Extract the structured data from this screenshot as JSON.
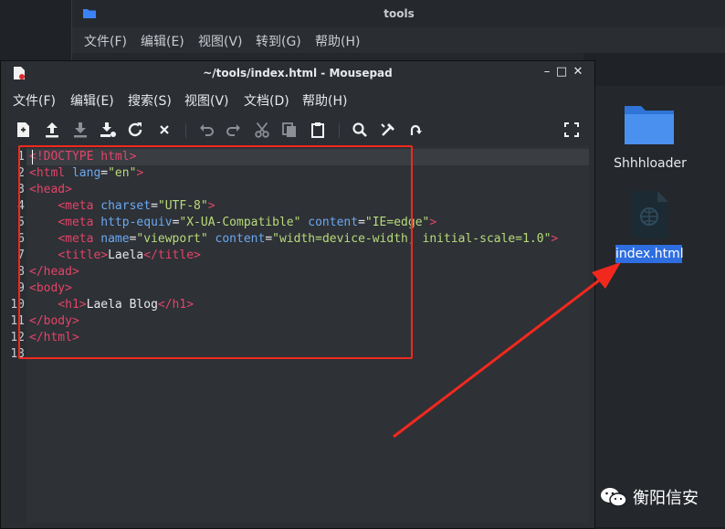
{
  "background_window": {
    "title": "tools",
    "menu": [
      "文件(F)",
      "编辑(E)",
      "视图(V)",
      "转到(G)",
      "帮助(H)"
    ]
  },
  "desktop": {
    "folder_label": "Shhhloader",
    "file_label": "index.html"
  },
  "editor_window": {
    "title": "~/tools/index.html - Mousepad",
    "menu": [
      "文件(F)",
      "编辑(E)",
      "搜索(S)",
      "视图(V)",
      "文档(D)",
      "帮助(H)"
    ],
    "toolbar_icons": [
      "new-document-icon",
      "open-icon",
      "save-icon",
      "save-as-icon",
      "reload-icon",
      "close-icon",
      "undo-icon",
      "redo-icon",
      "cut-icon",
      "copy-icon",
      "paste-icon",
      "find-icon",
      "find-replace-icon",
      "goto-icon",
      "fullscreen-icon"
    ],
    "window_controls": [
      "minimize-icon",
      "maximize-icon",
      "close-icon"
    ]
  },
  "code": {
    "line_numbers": [
      "1",
      "2",
      "3",
      "4",
      "5",
      "6",
      "7",
      "8",
      "9",
      "10",
      "11",
      "12",
      "13"
    ],
    "lines": [
      "<!DOCTYPE html>",
      "<html lang=\"en\">",
      "<head>",
      "    <meta charset=\"UTF-8\">",
      "    <meta http-equiv=\"X-UA-Compatible\" content=\"IE=edge\">",
      "    <meta name=\"viewport\" content=\"width=device-width, initial-scale=1.0\">",
      "    <title>Laela</title>",
      "</head>",
      "<body>",
      "    <h1>Laela Blog</h1>",
      "</body>",
      "</html>",
      ""
    ]
  },
  "watermark": {
    "text": "衡阳信安",
    "icon": "wechat-icon"
  },
  "colors": {
    "tag": "#e34468",
    "attribute": "#6aa9f0",
    "string": "#b8db7a",
    "annotation_red": "#f2281e",
    "selection_blue": "#2f6ee0"
  }
}
